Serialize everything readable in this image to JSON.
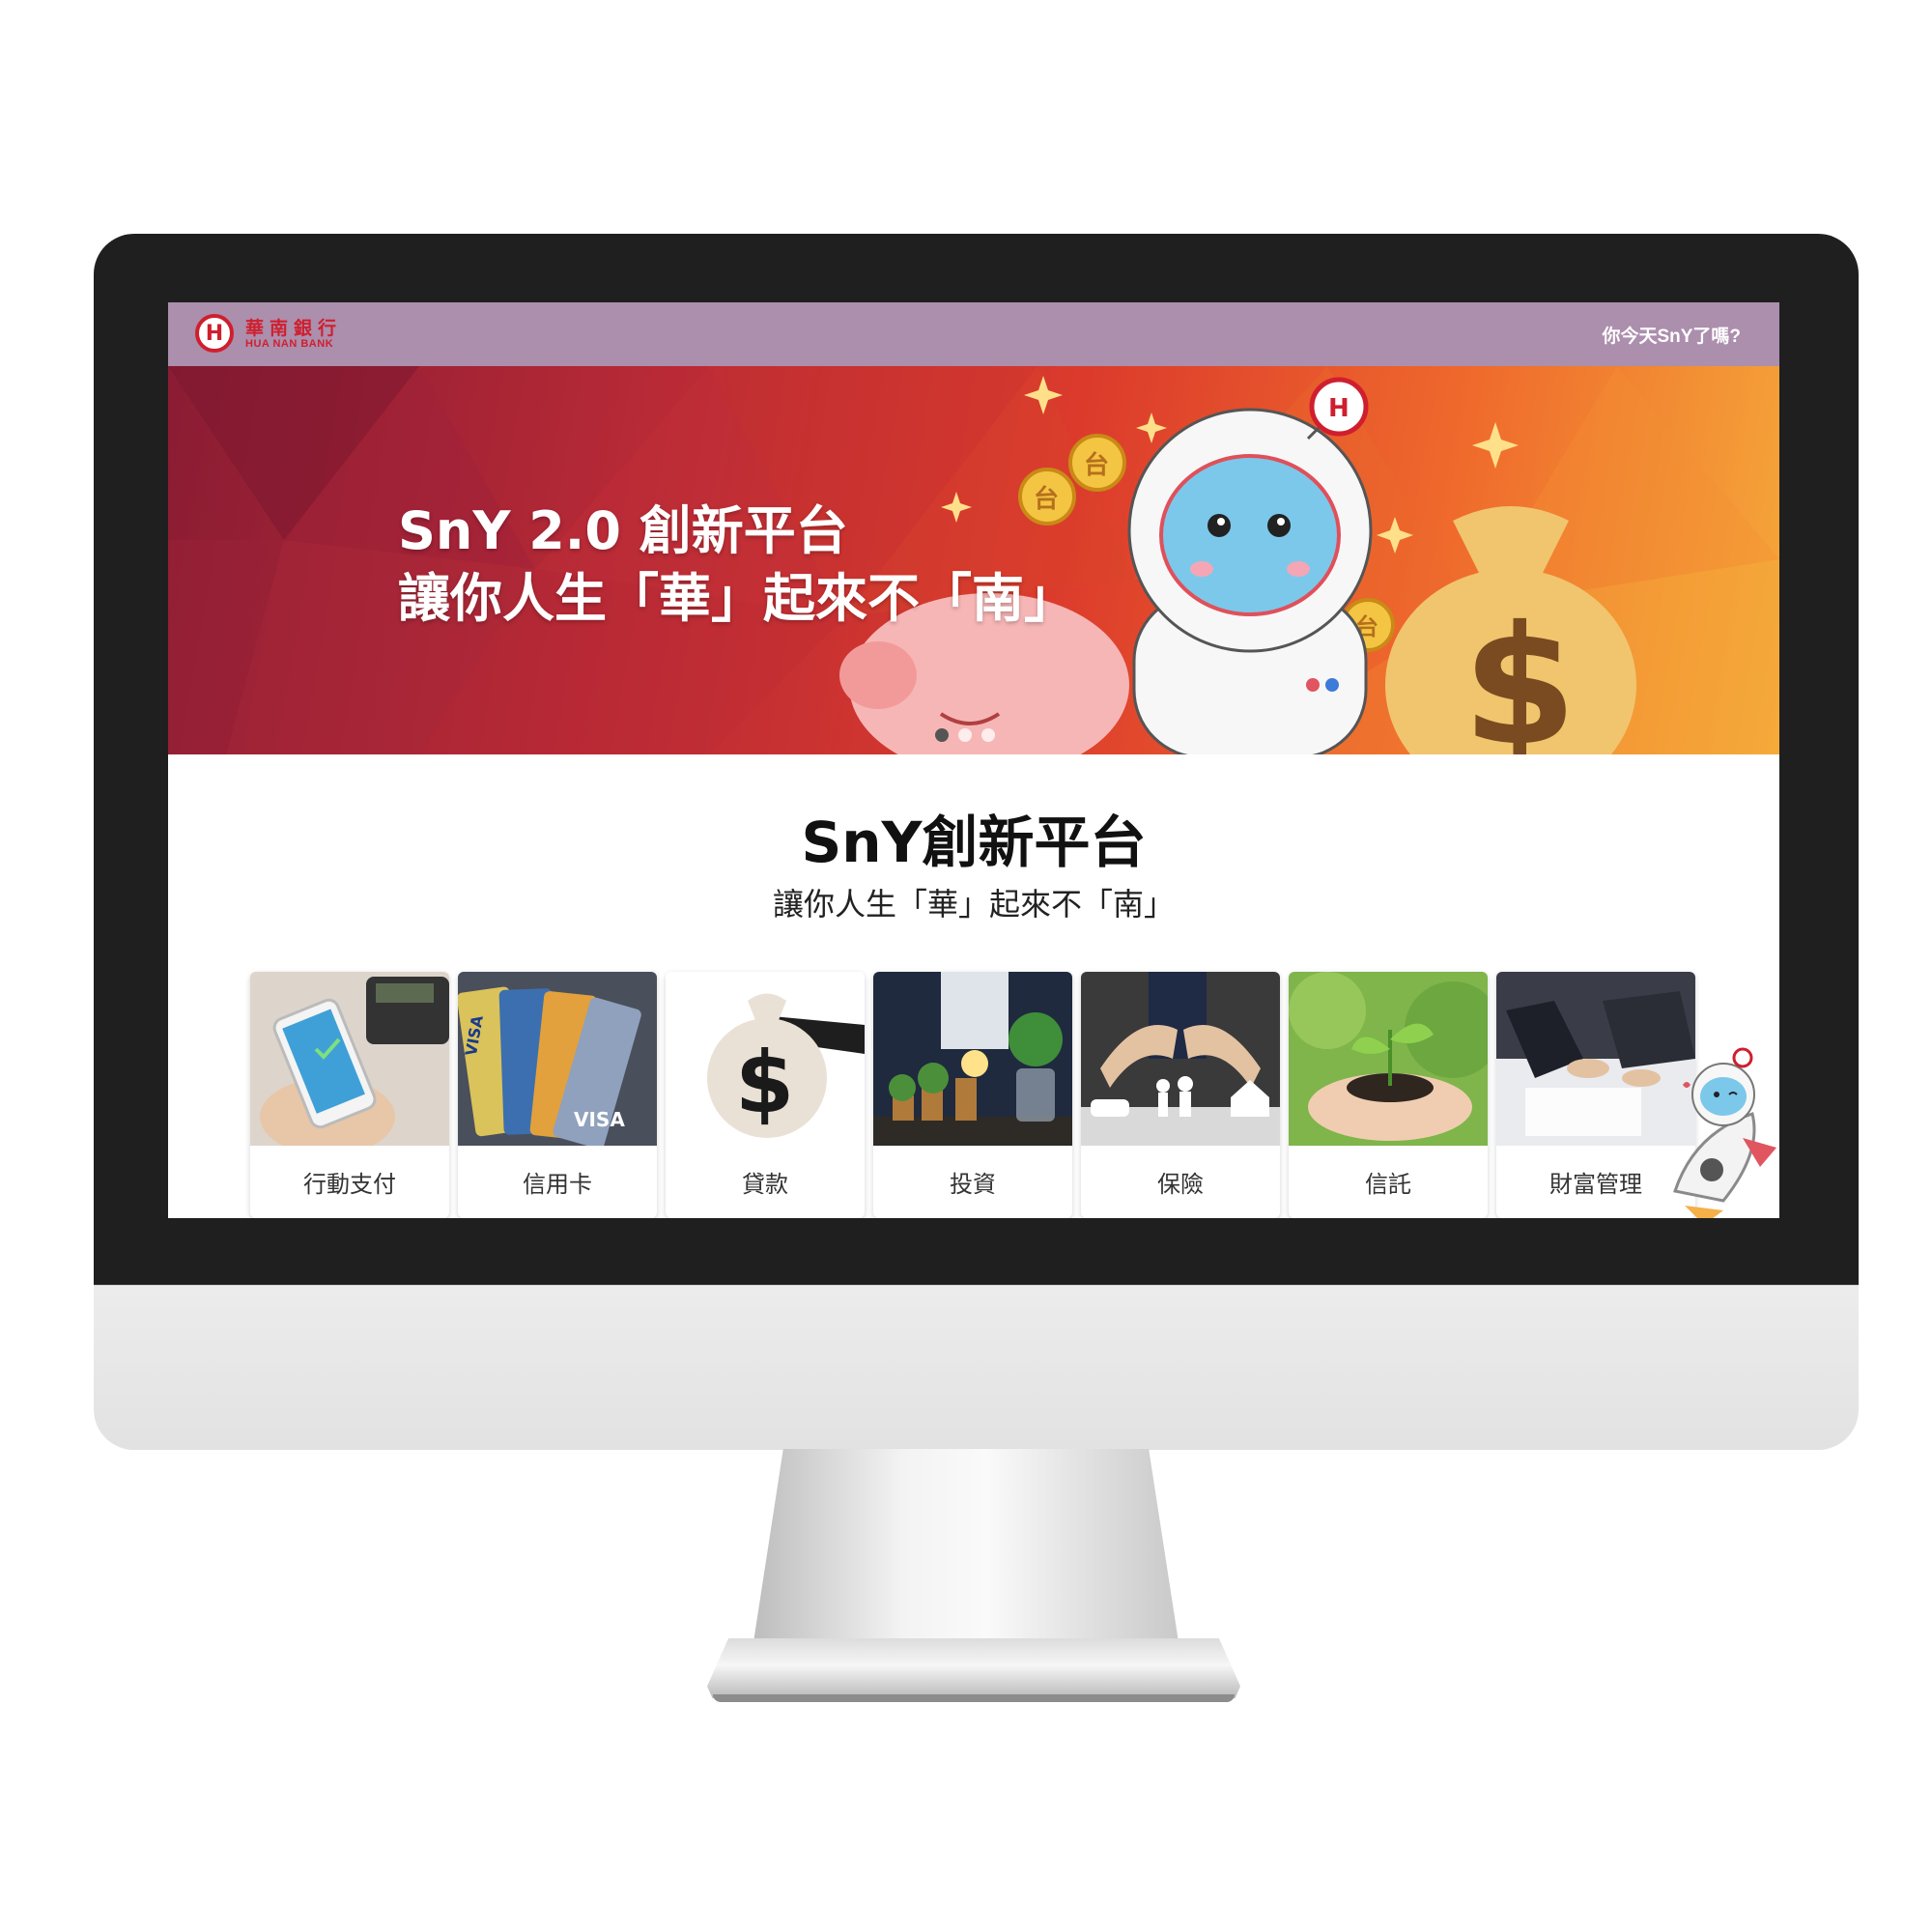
{
  "colors": {
    "topbar": "#ac8ead",
    "brand_red": "#cf1f2e",
    "banner_gradient": [
      "#8a1c33",
      "#dc3b2c",
      "#f5a93a"
    ]
  },
  "topbar": {
    "logo_cn": "華南銀行",
    "logo_en": "HUA NAN BANK",
    "link": "你今天SnY了嗎?"
  },
  "banner": {
    "title_line1": "SnY 2.0 創新平台",
    "title_line2": "讓你人生「華」起來不「南」",
    "slides": 3,
    "active_slide": 1,
    "coin_text": "台"
  },
  "main": {
    "title": "SnY創新平台",
    "subtitle": "讓你人生「華」起來不「南」"
  },
  "categories": [
    {
      "label": "行動支付",
      "icon": "mobile-payment-photo"
    },
    {
      "label": "信用卡",
      "icon": "credit-cards-photo"
    },
    {
      "label": "貸款",
      "icon": "money-bag-photo"
    },
    {
      "label": "投資",
      "icon": "investment-plants-photo"
    },
    {
      "label": "保險",
      "icon": "family-protection-photo"
    },
    {
      "label": "信託",
      "icon": "seedling-hands-photo"
    },
    {
      "label": "財富管理",
      "icon": "business-meeting-photo"
    }
  ]
}
